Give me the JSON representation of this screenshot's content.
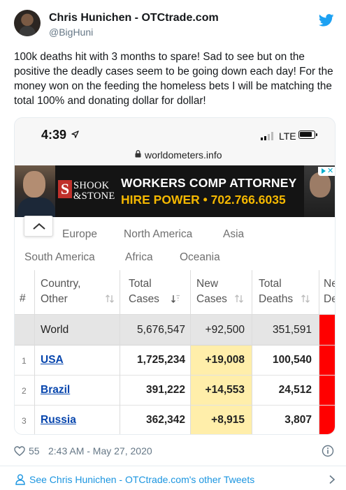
{
  "tweet": {
    "display_name": "Chris Hunichen - OTCtrade.com",
    "handle": "@BigHuni",
    "text": "100k deaths hit with 3 months to spare!  Sad to see but on the positive the deadly cases seem to be going down each day!  For the money won on the feeding the homeless bets I will be matching the total 100% and donating dollar for dollar!",
    "likes": "55",
    "timestamp": "2:43 AM - May 27, 2020",
    "footer_link": "See Chris Hunichen - OTCtrade.com's other Tweets",
    "brand_color": "#1da1f2"
  },
  "phone": {
    "time": "4:39",
    "network": "LTE",
    "url": "worldometers.info"
  },
  "ad": {
    "brand_initial": "S",
    "brand_line1": "SHOOK",
    "brand_line2": "&STONE",
    "headline": "WORKERS COMP ATTORNEY",
    "cta": "HIRE POWER • 702.766.6035",
    "close_glyph": "✕"
  },
  "continents": {
    "row1": [
      "Europe",
      "North America",
      "Asia"
    ],
    "row2": [
      "South America",
      "Africa",
      "Oceania"
    ]
  },
  "table": {
    "headers": {
      "rank": "#",
      "country_line1": "Country,",
      "country_line2": "Other",
      "total_cases_line1": "Total",
      "total_cases_line2": "Cases",
      "new_cases_line1": "New",
      "new_cases_line2": "Cases",
      "total_deaths_line1": "Total",
      "total_deaths_line2": "Deaths",
      "new_deaths_line1": "Ne",
      "new_deaths_line2": "De"
    },
    "world": {
      "country": "World",
      "total_cases": "5,676,547",
      "new_cases": "+92,500",
      "total_deaths": "351,591"
    },
    "rows": [
      {
        "rank": "1",
        "country": "USA",
        "total_cases": "1,725,234",
        "new_cases": "+19,008",
        "total_deaths": "100,540"
      },
      {
        "rank": "2",
        "country": "Brazil",
        "total_cases": "391,222",
        "new_cases": "+14,553",
        "total_deaths": "24,512"
      },
      {
        "rank": "3",
        "country": "Russia",
        "total_cases": "362,342",
        "new_cases": "+8,915",
        "total_deaths": "3,807"
      }
    ],
    "new_cases_highlight": "#ffeeaa",
    "new_deaths_highlight": "#ff0000",
    "link_color": "#0645ad"
  }
}
